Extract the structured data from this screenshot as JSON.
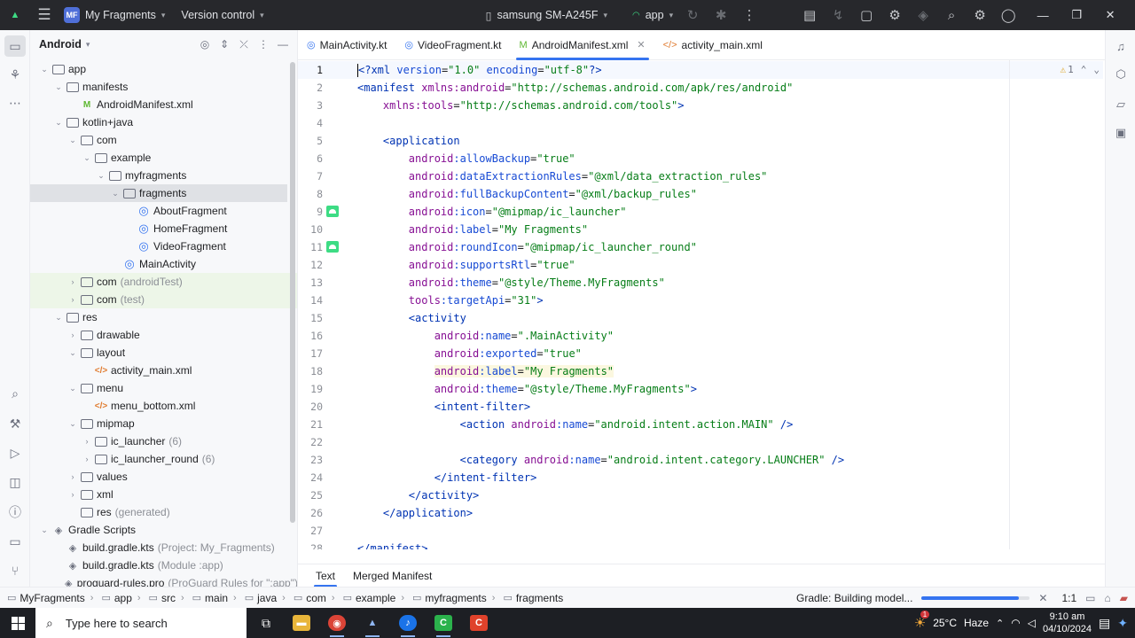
{
  "titlebar": {
    "project_badge": "MF",
    "project_name": "My Fragments",
    "vcs": "Version control",
    "device": "samsung SM-A245F",
    "run_config": "app"
  },
  "project_panel": {
    "title": "Android",
    "tree": [
      {
        "label": "app",
        "depth": 0,
        "arrow": "open",
        "icon": "folder"
      },
      {
        "label": "manifests",
        "depth": 1,
        "arrow": "open",
        "icon": "folder"
      },
      {
        "label": "AndroidManifest.xml",
        "depth": 2,
        "arrow": "none",
        "icon": "manifest"
      },
      {
        "label": "kotlin+java",
        "depth": 1,
        "arrow": "open",
        "icon": "folder"
      },
      {
        "label": "com",
        "depth": 2,
        "arrow": "open",
        "icon": "folder"
      },
      {
        "label": "example",
        "depth": 3,
        "arrow": "open",
        "icon": "folder"
      },
      {
        "label": "myfragments",
        "depth": 4,
        "arrow": "open",
        "icon": "folder"
      },
      {
        "label": "fragments",
        "depth": 5,
        "arrow": "open",
        "icon": "folder",
        "selected": true
      },
      {
        "label": "AboutFragment",
        "depth": 6,
        "arrow": "none",
        "icon": "class"
      },
      {
        "label": "HomeFragment",
        "depth": 6,
        "arrow": "none",
        "icon": "class"
      },
      {
        "label": "VideoFragment",
        "depth": 6,
        "arrow": "none",
        "icon": "class"
      },
      {
        "label": "MainActivity",
        "depth": 5,
        "arrow": "none",
        "icon": "class"
      },
      {
        "label": "com",
        "suffix": "(androidTest)",
        "depth": 2,
        "arrow": "closed",
        "icon": "folder",
        "green": true
      },
      {
        "label": "com",
        "suffix": "(test)",
        "depth": 2,
        "arrow": "closed",
        "icon": "folder",
        "green": true
      },
      {
        "label": "res",
        "depth": 1,
        "arrow": "open",
        "icon": "folder"
      },
      {
        "label": "drawable",
        "depth": 2,
        "arrow": "closed",
        "icon": "folder"
      },
      {
        "label": "layout",
        "depth": 2,
        "arrow": "open",
        "icon": "folder"
      },
      {
        "label": "activity_main.xml",
        "depth": 3,
        "arrow": "none",
        "icon": "xml"
      },
      {
        "label": "menu",
        "depth": 2,
        "arrow": "open",
        "icon": "folder"
      },
      {
        "label": "menu_bottom.xml",
        "depth": 3,
        "arrow": "none",
        "icon": "xml"
      },
      {
        "label": "mipmap",
        "depth": 2,
        "arrow": "open",
        "icon": "folder"
      },
      {
        "label": "ic_launcher",
        "suffix": "(6)",
        "depth": 3,
        "arrow": "closed",
        "icon": "folder"
      },
      {
        "label": "ic_launcher_round",
        "suffix": "(6)",
        "depth": 3,
        "arrow": "closed",
        "icon": "folder"
      },
      {
        "label": "values",
        "depth": 2,
        "arrow": "closed",
        "icon": "folder"
      },
      {
        "label": "xml",
        "depth": 2,
        "arrow": "closed",
        "icon": "folder"
      },
      {
        "label": "res",
        "suffix": "(generated)",
        "depth": 2,
        "arrow": "none",
        "icon": "folder"
      },
      {
        "label": "Gradle Scripts",
        "depth": 0,
        "arrow": "open",
        "icon": "gradle"
      },
      {
        "label": "build.gradle.kts",
        "suffix": "(Project: My_Fragments)",
        "depth": 1,
        "arrow": "none",
        "icon": "gradle"
      },
      {
        "label": "build.gradle.kts",
        "suffix": "(Module :app)",
        "depth": 1,
        "arrow": "none",
        "icon": "gradle"
      },
      {
        "label": "proguard-rules.pro",
        "suffix": "(ProGuard Rules for \":app\")",
        "depth": 1,
        "arrow": "none",
        "icon": "gradle"
      }
    ]
  },
  "editor": {
    "tabs": [
      {
        "label": "MainActivity.kt",
        "icon": "kotlin",
        "active": false
      },
      {
        "label": "VideoFragment.kt",
        "icon": "kotlin",
        "active": false
      },
      {
        "label": "AndroidManifest.xml",
        "icon": "manifest",
        "active": true
      },
      {
        "label": "activity_main.xml",
        "icon": "xml",
        "active": false
      }
    ],
    "warning_count": "1",
    "badge_lines": [
      9,
      11
    ],
    "highlight_line": 18,
    "lines": [
      [
        [
          "t-tag",
          "<?xml "
        ],
        [
          "t-attr",
          "version"
        ],
        [
          "t-plain",
          "="
        ],
        [
          "t-val",
          "\"1.0\""
        ],
        [
          "t-plain",
          " "
        ],
        [
          "t-attr",
          "encoding"
        ],
        [
          "t-plain",
          "="
        ],
        [
          "t-val",
          "\"utf-8\""
        ],
        [
          "t-tag",
          "?>"
        ]
      ],
      [
        [
          "t-tag",
          "<manifest "
        ],
        [
          "t-ns",
          "xmlns:android"
        ],
        [
          "t-plain",
          "="
        ],
        [
          "t-val",
          "\"http://schemas.android.com/apk/res/android\""
        ]
      ],
      [
        [
          "t-plain",
          "    "
        ],
        [
          "t-ns",
          "xmlns:tools"
        ],
        [
          "t-plain",
          "="
        ],
        [
          "t-val",
          "\"http://schemas.android.com/tools\""
        ],
        [
          "t-tag",
          ">"
        ]
      ],
      [],
      [
        [
          "t-plain",
          "    "
        ],
        [
          "t-tag",
          "<application"
        ]
      ],
      [
        [
          "t-plain",
          "        "
        ],
        [
          "t-ns",
          "android"
        ],
        [
          "t-attr",
          ":allowBackup"
        ],
        [
          "t-plain",
          "="
        ],
        [
          "t-val",
          "\"true\""
        ]
      ],
      [
        [
          "t-plain",
          "        "
        ],
        [
          "t-ns",
          "android"
        ],
        [
          "t-attr",
          ":dataExtractionRules"
        ],
        [
          "t-plain",
          "="
        ],
        [
          "t-val",
          "\"@xml/data_extraction_rules\""
        ]
      ],
      [
        [
          "t-plain",
          "        "
        ],
        [
          "t-ns",
          "android"
        ],
        [
          "t-attr",
          ":fullBackupContent"
        ],
        [
          "t-plain",
          "="
        ],
        [
          "t-val",
          "\"@xml/backup_rules\""
        ]
      ],
      [
        [
          "t-plain",
          "        "
        ],
        [
          "t-ns",
          "android"
        ],
        [
          "t-attr",
          ":icon"
        ],
        [
          "t-plain",
          "="
        ],
        [
          "t-val",
          "\"@mipmap/ic_launcher\""
        ]
      ],
      [
        [
          "t-plain",
          "        "
        ],
        [
          "t-ns",
          "android"
        ],
        [
          "t-attr",
          ":label"
        ],
        [
          "t-plain",
          "="
        ],
        [
          "t-val",
          "\"My Fragments\""
        ]
      ],
      [
        [
          "t-plain",
          "        "
        ],
        [
          "t-ns",
          "android"
        ],
        [
          "t-attr",
          ":roundIcon"
        ],
        [
          "t-plain",
          "="
        ],
        [
          "t-val",
          "\"@mipmap/ic_launcher_round\""
        ]
      ],
      [
        [
          "t-plain",
          "        "
        ],
        [
          "t-ns",
          "android"
        ],
        [
          "t-attr",
          ":supportsRtl"
        ],
        [
          "t-plain",
          "="
        ],
        [
          "t-val",
          "\"true\""
        ]
      ],
      [
        [
          "t-plain",
          "        "
        ],
        [
          "t-ns",
          "android"
        ],
        [
          "t-attr",
          ":theme"
        ],
        [
          "t-plain",
          "="
        ],
        [
          "t-val",
          "\"@style/Theme.MyFragments\""
        ]
      ],
      [
        [
          "t-plain",
          "        "
        ],
        [
          "t-ns",
          "tools"
        ],
        [
          "t-attr",
          ":targetApi"
        ],
        [
          "t-plain",
          "="
        ],
        [
          "t-val",
          "\"31\""
        ],
        [
          "t-tag",
          ">"
        ]
      ],
      [
        [
          "t-plain",
          "        "
        ],
        [
          "t-tag",
          "<activity"
        ]
      ],
      [
        [
          "t-plain",
          "            "
        ],
        [
          "t-ns",
          "android"
        ],
        [
          "t-attr",
          ":name"
        ],
        [
          "t-plain",
          "="
        ],
        [
          "t-val",
          "\".MainActivity\""
        ]
      ],
      [
        [
          "t-plain",
          "            "
        ],
        [
          "t-ns",
          "android"
        ],
        [
          "t-attr",
          ":exported"
        ],
        [
          "t-plain",
          "="
        ],
        [
          "t-val",
          "\"true\""
        ]
      ],
      [
        [
          "t-plain",
          "            "
        ],
        [
          "t-ns",
          "android"
        ],
        [
          "t-attr",
          ":label"
        ],
        [
          "t-plain",
          "="
        ],
        [
          "t-val",
          "\"My Fragments\""
        ]
      ],
      [
        [
          "t-plain",
          "            "
        ],
        [
          "t-ns",
          "android"
        ],
        [
          "t-attr",
          ":theme"
        ],
        [
          "t-plain",
          "="
        ],
        [
          "t-val",
          "\"@style/Theme.MyFragments\""
        ],
        [
          "t-tag",
          ">"
        ]
      ],
      [
        [
          "t-plain",
          "            "
        ],
        [
          "t-tag",
          "<intent-filter>"
        ]
      ],
      [
        [
          "t-plain",
          "                "
        ],
        [
          "t-tag",
          "<action "
        ],
        [
          "t-ns",
          "android"
        ],
        [
          "t-attr",
          ":name"
        ],
        [
          "t-plain",
          "="
        ],
        [
          "t-val",
          "\"android.intent.action.MAIN\""
        ],
        [
          "t-tag",
          " />"
        ]
      ],
      [],
      [
        [
          "t-plain",
          "                "
        ],
        [
          "t-tag",
          "<category "
        ],
        [
          "t-ns",
          "android"
        ],
        [
          "t-attr",
          ":name"
        ],
        [
          "t-plain",
          "="
        ],
        [
          "t-val",
          "\"android.intent.category.LAUNCHER\""
        ],
        [
          "t-tag",
          " />"
        ]
      ],
      [
        [
          "t-plain",
          "            "
        ],
        [
          "t-tag",
          "</intent-filter>"
        ]
      ],
      [
        [
          "t-plain",
          "        "
        ],
        [
          "t-tag",
          "</activity>"
        ]
      ],
      [
        [
          "t-plain",
          "    "
        ],
        [
          "t-tag",
          "</application>"
        ]
      ],
      [],
      [
        [
          "t-tag",
          "</manifest>"
        ]
      ]
    ],
    "bottom_tabs": [
      {
        "label": "Text",
        "active": true
      },
      {
        "label": "Merged Manifest",
        "active": false
      }
    ]
  },
  "statusbar": {
    "breadcrumbs": [
      "MyFragments",
      "app",
      "src",
      "main",
      "java",
      "com",
      "example",
      "myfragments",
      "fragments"
    ],
    "build_status": "Gradle: Building model...",
    "progress": 0.9,
    "cursor_pos": "1:1"
  },
  "taskbar": {
    "search_placeholder": "Type here to search",
    "weather_badge": "1",
    "temperature": "25°C",
    "weather": "Haze",
    "time": "9:10 am",
    "date": "04/10/2024"
  },
  "colors": {
    "accent": "#3574f0",
    "titlebar_bg": "#27282c",
    "xml_tag": "#0033b3",
    "xml_value": "#067d17",
    "xml_namespace": "#871094",
    "android_green": "#3ddc84"
  }
}
